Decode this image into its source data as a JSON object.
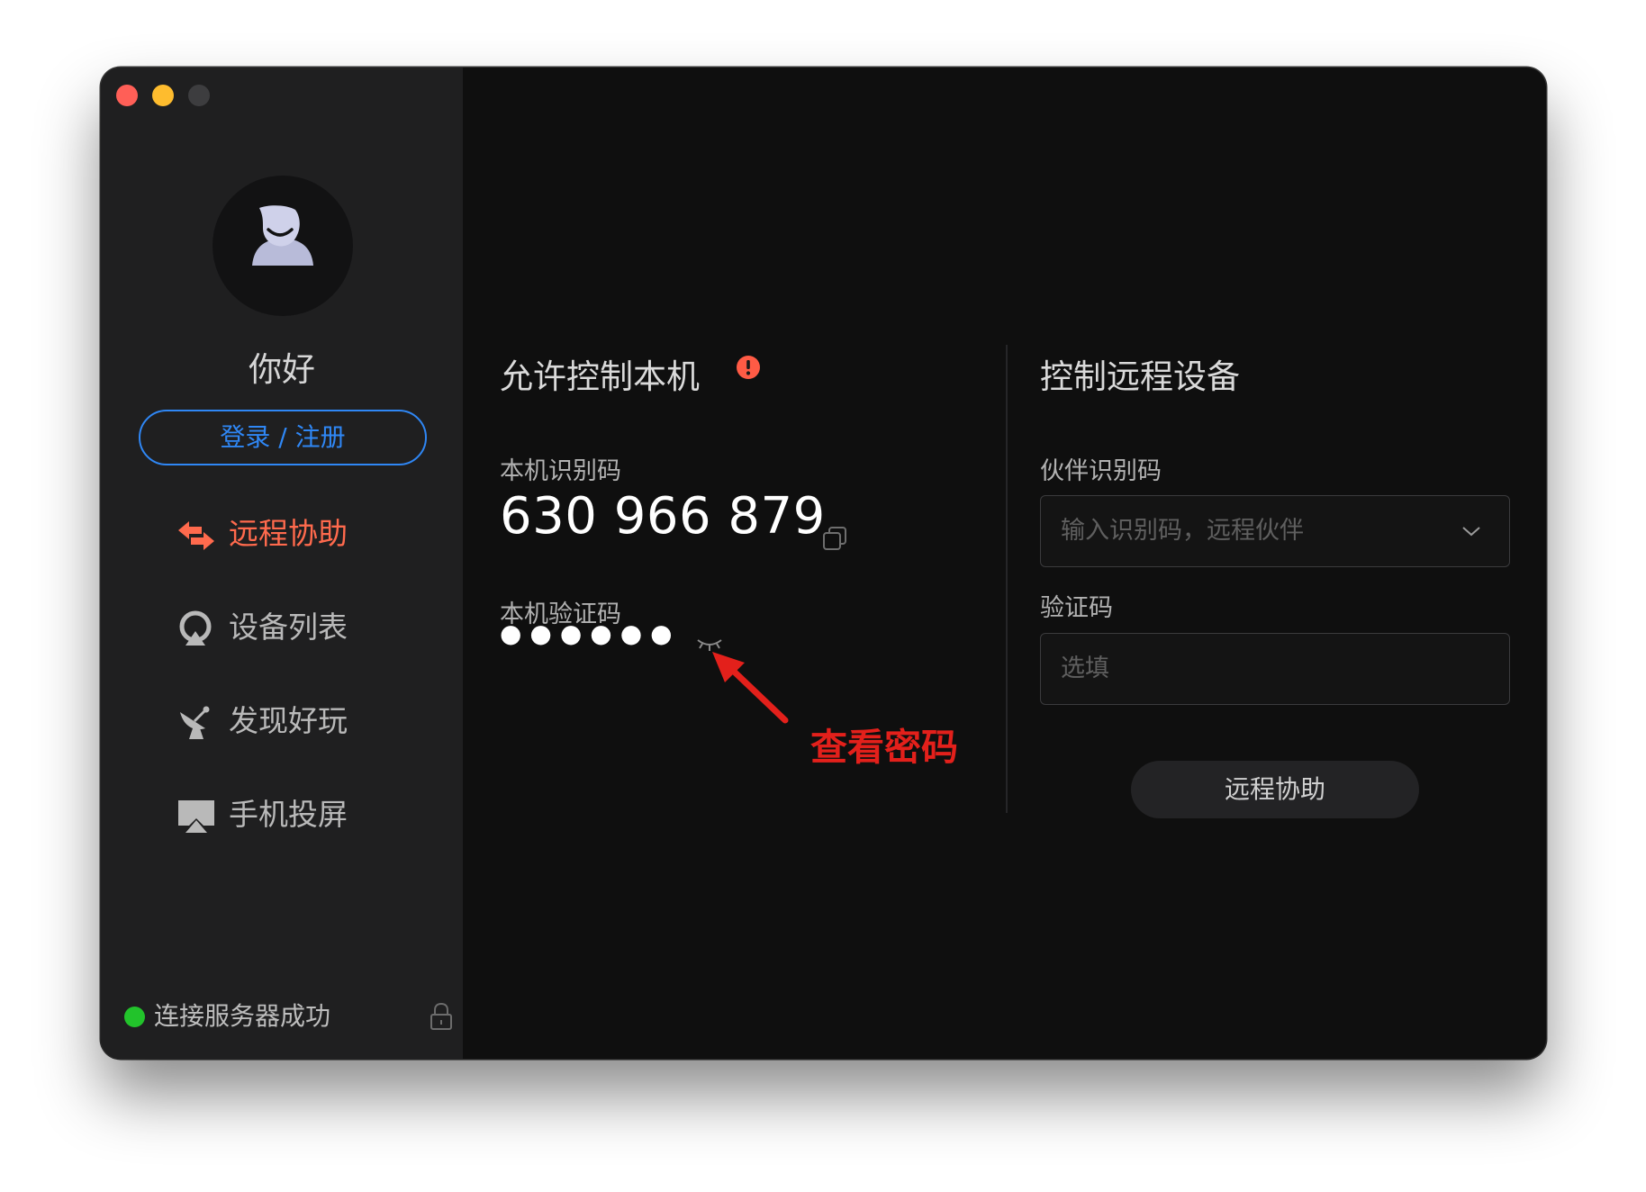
{
  "sidebar": {
    "greeting": "你好",
    "login_button": "登录 / 注册",
    "nav": [
      {
        "label": "远程协助",
        "icon": "remote-assist-icon",
        "active": true
      },
      {
        "label": "设备列表",
        "icon": "device-list-icon",
        "active": false
      },
      {
        "label": "发现好玩",
        "icon": "discover-icon",
        "active": false
      },
      {
        "label": "手机投屏",
        "icon": "screen-mirror-icon",
        "active": false
      }
    ],
    "status_text": "连接服务器成功",
    "status_color": "#22c32b"
  },
  "allow_control": {
    "title": "允许控制本机",
    "id_label": "本机识别码",
    "id_value": "630 966 879",
    "code_label": "本机验证码",
    "code_masked": "●●●●●●",
    "annotation": "查看密码"
  },
  "remote_control": {
    "title": "控制远程设备",
    "partner_label": "伙伴识别码",
    "partner_placeholder": "输入识别码，远程伙伴",
    "code_label": "验证码",
    "code_placeholder": "选填",
    "connect_button": "远程协助"
  },
  "colors": {
    "accent": "#2f87f5",
    "active_nav": "#ff6a4d",
    "annotation": "#e3201b",
    "warning": "#ff5b45"
  }
}
